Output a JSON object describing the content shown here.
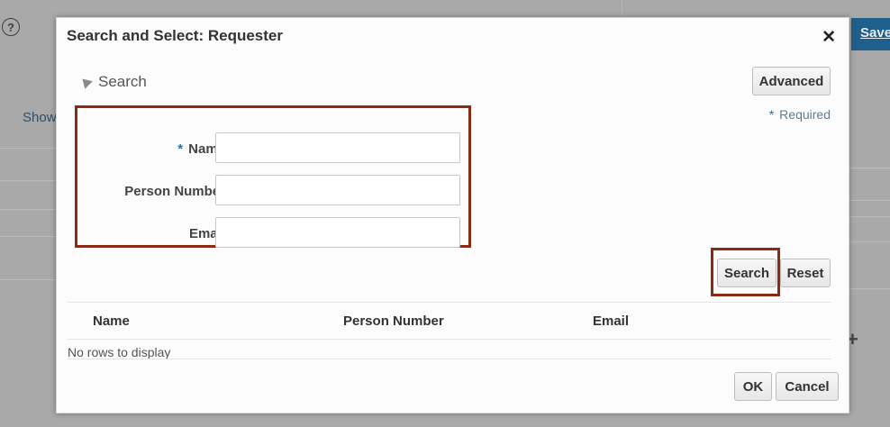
{
  "background": {
    "save_label": "Save",
    "show_label": "Show"
  },
  "dialog": {
    "title": "Search and Select: Requester",
    "close_glyph": "✕",
    "section_label": "Search",
    "advanced_label": "Advanced",
    "required_note": "Required",
    "required_star": "*",
    "fields": [
      {
        "label": "Name",
        "required": true,
        "value": "",
        "placeholder": ""
      },
      {
        "label": "Person Number",
        "required": false,
        "value": "",
        "placeholder": ""
      },
      {
        "label": "Email",
        "required": false,
        "value": "",
        "placeholder": ""
      }
    ],
    "search_label": "Search",
    "reset_label": "Reset",
    "table": {
      "columns": [
        "Name",
        "Person Number",
        "Email"
      ],
      "empty_text": "No rows to display"
    },
    "ok_label": "OK",
    "cancel_label": "Cancel"
  },
  "colors": {
    "highlight": "#8b2b16",
    "required_star": "#2e6ea3",
    "primary_save": "#1f5f8c"
  },
  "icons": {
    "help": "help-icon",
    "close": "close-icon",
    "section_toggle": "collapse-triangle-icon"
  }
}
